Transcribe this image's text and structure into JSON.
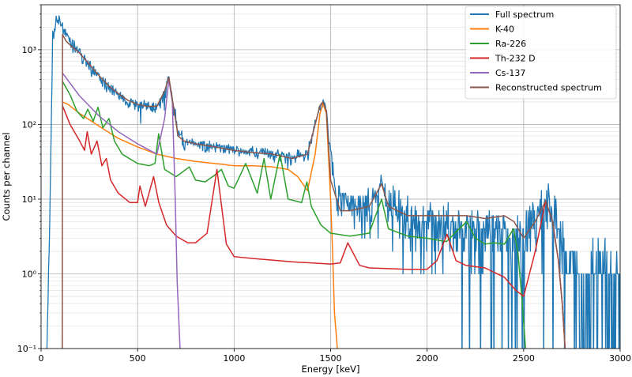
{
  "chart_data": {
    "type": "line",
    "xlabel": "Energy [keV]",
    "ylabel": "Counts per channel",
    "xlim": [
      0,
      3000
    ],
    "ylim": [
      0.1,
      4000
    ],
    "yscale": "log",
    "grid": true,
    "legend_position": "top-right",
    "x_ticks": [
      0,
      500,
      1000,
      1500,
      2000,
      2500,
      3000
    ],
    "x_tick_labels": [
      "0",
      "500",
      "1000",
      "1500",
      "2000",
      "2500",
      "3000"
    ],
    "y_ticks": [
      0.1,
      1,
      10,
      100,
      1000
    ],
    "y_tick_labels": [
      "10⁻¹",
      "10⁰",
      "10¹",
      "10²",
      "10³"
    ],
    "series": [
      {
        "name": "Full spectrum",
        "color": "#1f77b4",
        "noisy": true,
        "x": [
          30,
          45,
          60,
          80,
          100,
          120,
          150,
          200,
          250,
          300,
          350,
          400,
          450,
          500,
          550,
          580,
          610,
          640,
          662,
          685,
          710,
          740,
          800,
          900,
          1000,
          1100,
          1200,
          1300,
          1380,
          1420,
          1445,
          1461,
          1478,
          1500,
          1530,
          1600,
          1700,
          1764,
          1800,
          1900,
          2000,
          2100,
          2200,
          2300,
          2400,
          2500,
          2560,
          2614,
          2660,
          2700,
          2800,
          2900,
          3000
        ],
        "values": [
          0.1,
          5,
          1500,
          2500,
          2300,
          1900,
          1300,
          850,
          600,
          430,
          320,
          250,
          200,
          180,
          175,
          170,
          190,
          280,
          450,
          180,
          70,
          60,
          55,
          50,
          45,
          42,
          40,
          35,
          40,
          100,
          180,
          200,
          150,
          40,
          10,
          9,
          7,
          15,
          8,
          6,
          5,
          4,
          4,
          3.5,
          3,
          2.5,
          6,
          10,
          7,
          2,
          0.8,
          0.7,
          0.6
        ]
      },
      {
        "name": "K-40",
        "color": "#ff7f0e",
        "x": [
          110,
          140,
          200,
          300,
          400,
          500,
          600,
          700,
          800,
          900,
          1000,
          1100,
          1200,
          1280,
          1330,
          1380,
          1420,
          1445,
          1461,
          1478,
          1500,
          1510,
          1520,
          1535
        ],
        "values": [
          200,
          185,
          140,
          95,
          65,
          50,
          40,
          35,
          32,
          30,
          28,
          28,
          27,
          25,
          20,
          13,
          40,
          140,
          190,
          140,
          10,
          2,
          0.3,
          0.1
        ]
      },
      {
        "name": "Ra-226",
        "color": "#2ca02c",
        "x": [
          110,
          150,
          186,
          220,
          242,
          270,
          295,
          320,
          352,
          380,
          420,
          500,
          560,
          590,
          609,
          640,
          700,
          768,
          800,
          850,
          900,
          934,
          970,
          1000,
          1060,
          1120,
          1155,
          1190,
          1238,
          1280,
          1350,
          1377,
          1400,
          1450,
          1500,
          1600,
          1700,
          1764,
          1800,
          1900,
          2000,
          2100,
          2204,
          2250,
          2300,
          2350,
          2400,
          2447,
          2470,
          2490,
          2510
        ],
        "values": [
          380,
          250,
          150,
          120,
          160,
          110,
          170,
          90,
          120,
          60,
          40,
          30,
          28,
          30,
          75,
          25,
          20,
          27,
          18,
          17,
          21,
          25,
          15,
          14,
          30,
          12,
          35,
          10,
          40,
          10,
          9,
          17,
          8,
          4.5,
          3.5,
          3.2,
          3.5,
          10,
          4,
          3.2,
          3,
          2.7,
          5,
          3,
          2.5,
          2.6,
          2.5,
          4,
          2,
          0.5,
          0.1
        ]
      },
      {
        "name": "Th-232 D",
        "color": "#d62728",
        "x": [
          110,
          150,
          200,
          225,
          239,
          260,
          290,
          315,
          338,
          360,
          400,
          460,
          500,
          512,
          540,
          583,
          610,
          650,
          700,
          760,
          800,
          860,
          911,
          960,
          1000,
          1100,
          1300,
          1500,
          1550,
          1589,
          1650,
          1700,
          1900,
          2000,
          2050,
          2103,
          2150,
          2200,
          2300,
          2400,
          2460,
          2500,
          2560,
          2614,
          2650,
          2680,
          2700,
          2715
        ],
        "values": [
          180,
          100,
          60,
          45,
          80,
          40,
          60,
          28,
          35,
          18,
          12,
          9,
          9,
          15,
          8,
          20,
          9,
          4.5,
          3.2,
          2.6,
          2.6,
          3.5,
          25,
          2.5,
          1.7,
          1.6,
          1.45,
          1.35,
          1.4,
          2.6,
          1.3,
          1.2,
          1.15,
          1.15,
          1.5,
          3.4,
          1.5,
          1.3,
          1.2,
          0.9,
          0.6,
          0.5,
          2,
          9.5,
          5,
          1.5,
          0.4,
          0.1
        ]
      },
      {
        "name": "Cs-137",
        "color": "#9467bd",
        "x": [
          110,
          200,
          300,
          400,
          500,
          600,
          640,
          662,
          680,
          695,
          705,
          720
        ],
        "values": [
          490,
          240,
          130,
          80,
          55,
          40,
          120,
          400,
          200,
          10,
          0.8,
          0.1
        ]
      },
      {
        "name": "Reconstructed spectrum",
        "color": "#8c564b",
        "x": [
          110,
          111,
          130,
          160,
          200,
          250,
          300,
          350,
          400,
          450,
          500,
          550,
          600,
          640,
          662,
          685,
          710,
          740,
          800,
          900,
          1000,
          1100,
          1200,
          1300,
          1380,
          1420,
          1445,
          1461,
          1478,
          1500,
          1550,
          1600,
          1700,
          1764,
          1800,
          1900,
          2000,
          2100,
          2204,
          2300,
          2400,
          2450,
          2500,
          2560,
          2614,
          2650,
          2680,
          2700,
          2715
        ],
        "values": [
          0.1,
          1600,
          1300,
          1100,
          900,
          640,
          450,
          330,
          260,
          210,
          185,
          175,
          175,
          280,
          430,
          180,
          70,
          60,
          55,
          50,
          45,
          42,
          40,
          35,
          40,
          100,
          180,
          200,
          150,
          18,
          7,
          7,
          8,
          16,
          8,
          6,
          6,
          6,
          6,
          5.5,
          6,
          5,
          3,
          5,
          9.5,
          5,
          1.5,
          0.4,
          0.1
        ]
      }
    ]
  }
}
